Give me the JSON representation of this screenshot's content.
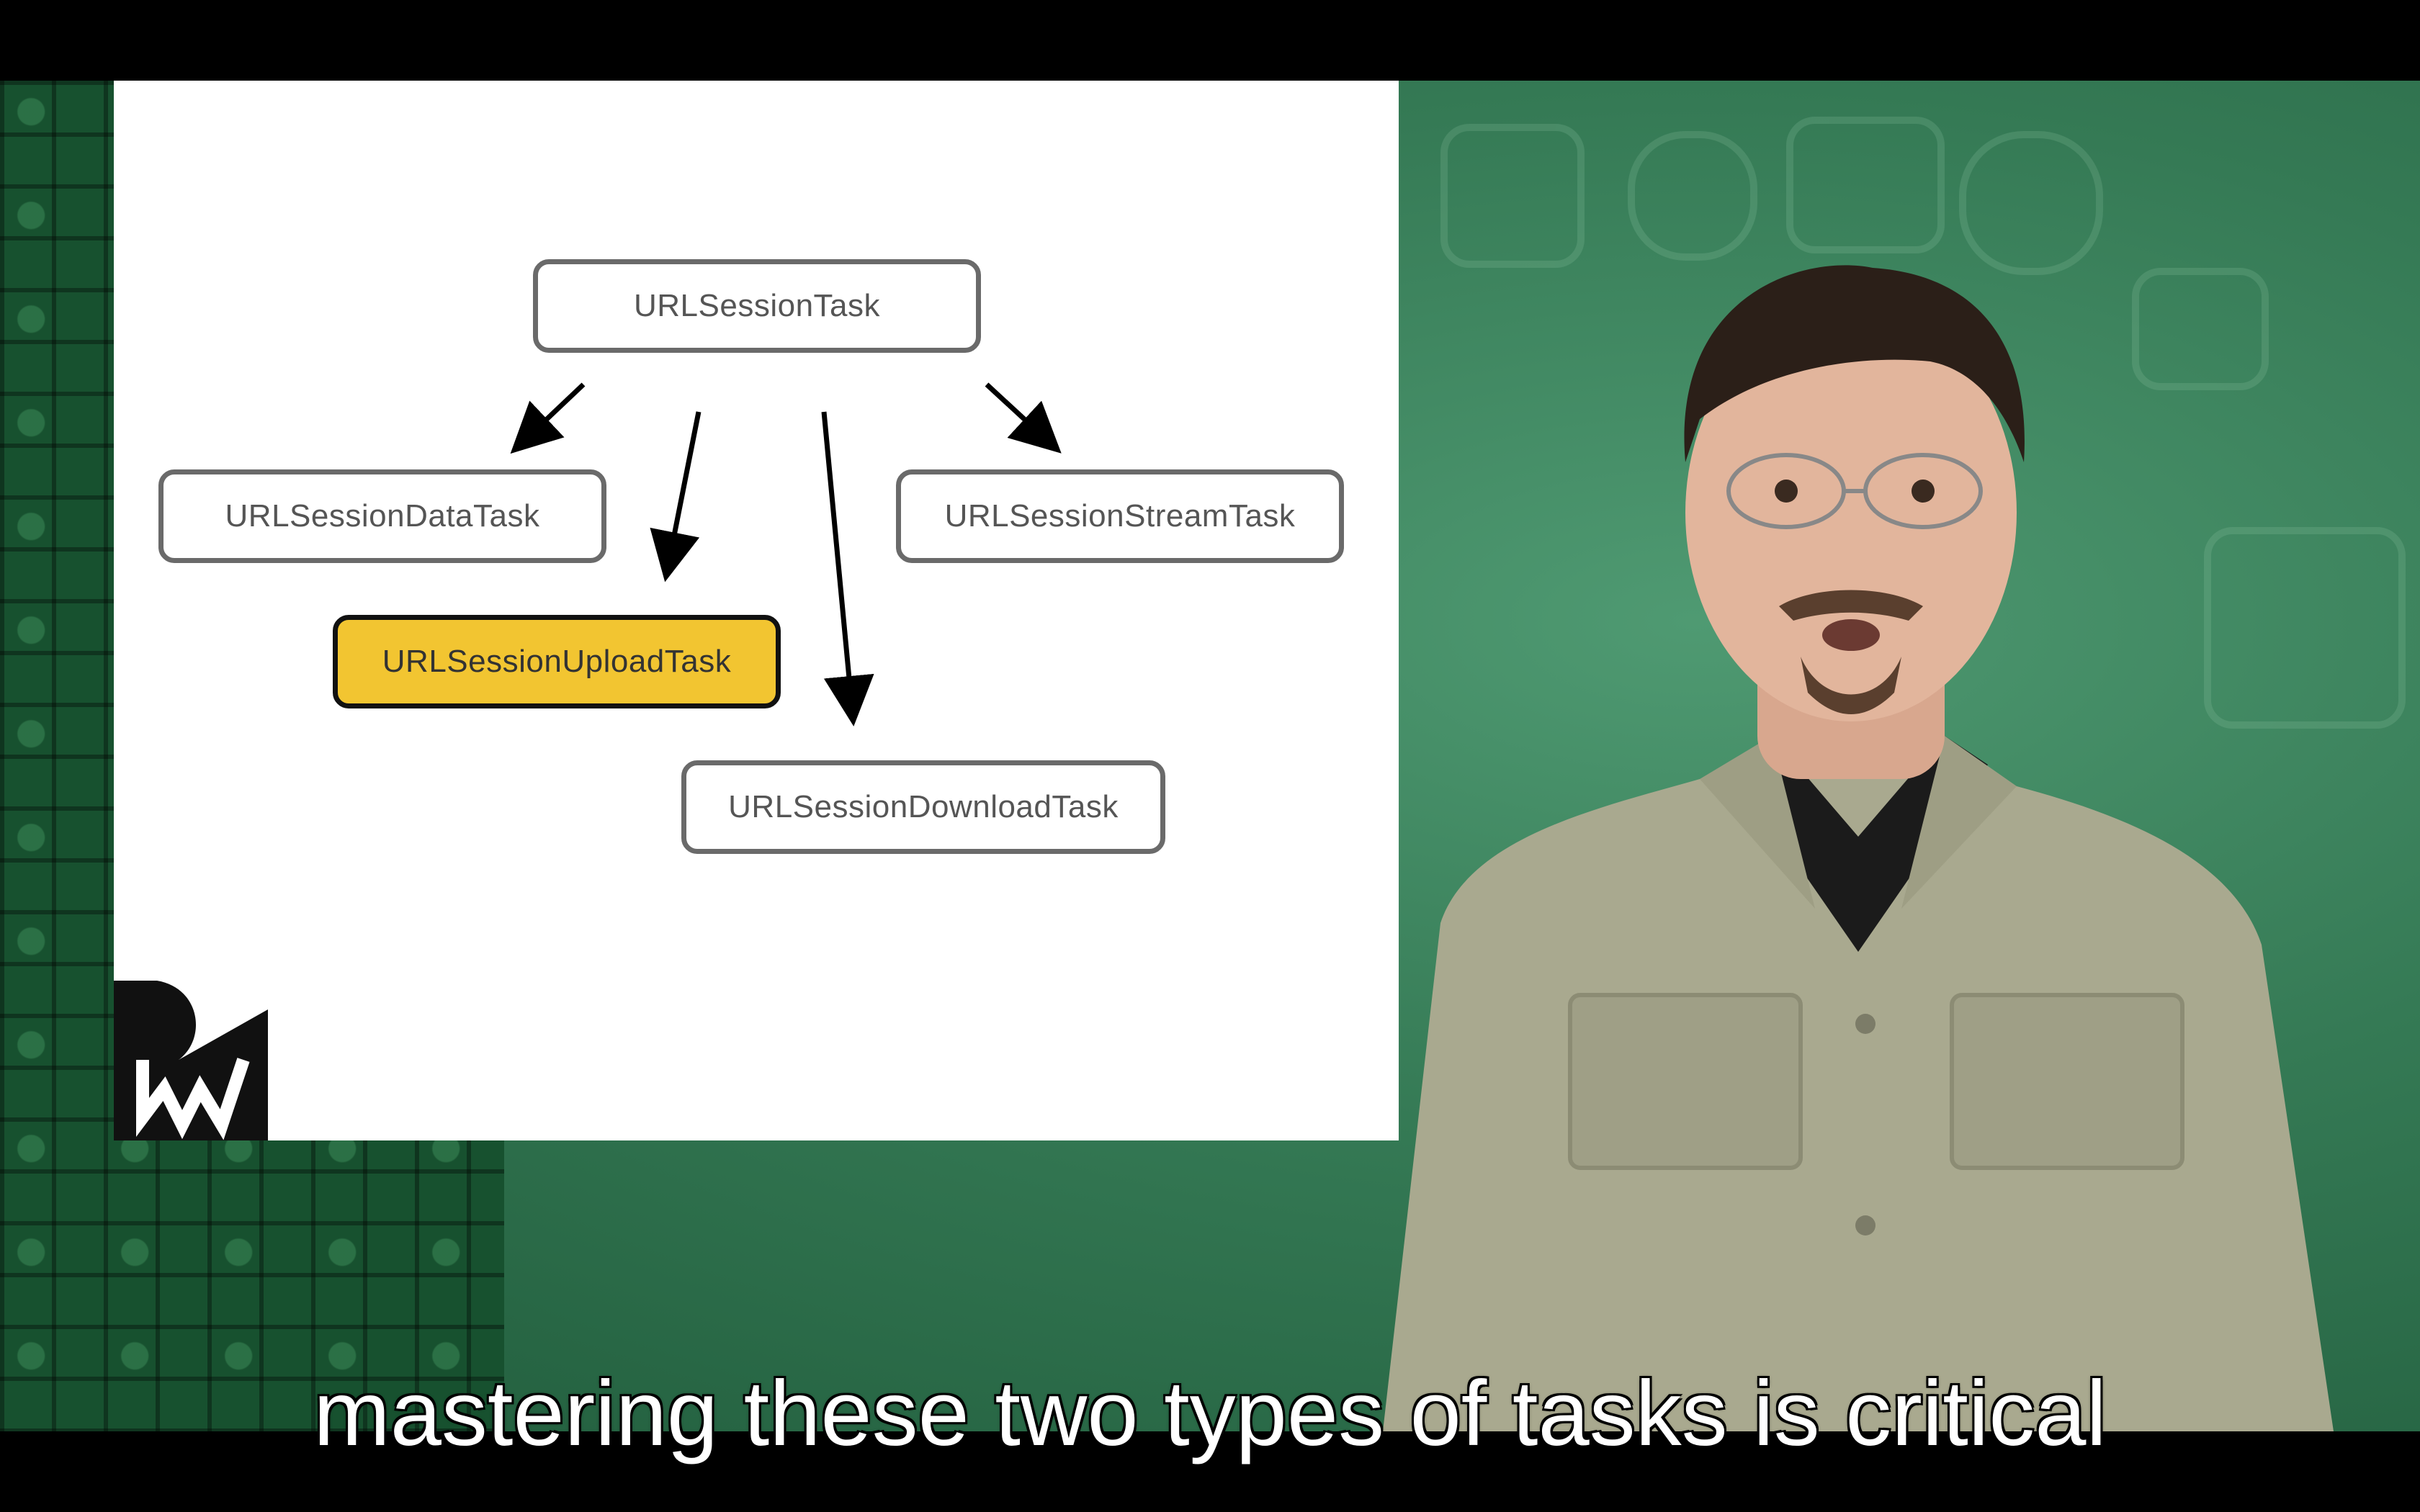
{
  "diagram": {
    "root": "URLSessionTask",
    "children": [
      {
        "label": "URLSessionDataTask",
        "highlighted": false
      },
      {
        "label": "URLSessionUploadTask",
        "highlighted": true
      },
      {
        "label": "URLSessionDownloadTask",
        "highlighted": false
      },
      {
        "label": "URLSessionStreamTask",
        "highlighted": false
      }
    ],
    "highlight_color": "#f2c531"
  },
  "caption": "mastering these two types of tasks is critical",
  "colors": {
    "background_green": "#357a55",
    "tile_green": "#17512f",
    "shirt": "#a9a98f"
  }
}
